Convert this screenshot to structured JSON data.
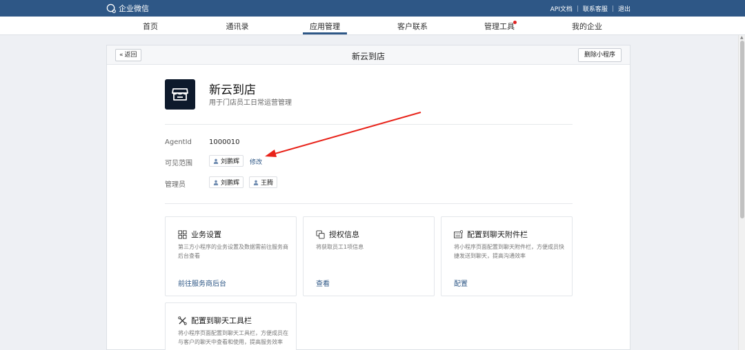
{
  "topbar": {
    "logo_text": "企业微信",
    "links": [
      "API文档",
      "联系客服",
      "退出"
    ]
  },
  "nav": {
    "items": [
      "首页",
      "通讯录",
      "应用管理",
      "客户联系",
      "管理工具",
      "我的企业"
    ],
    "active": "应用管理",
    "notify_color": "#e02020"
  },
  "panel": {
    "back_label": "返回",
    "title": "新云到店",
    "delete_label": "删除小程序"
  },
  "app": {
    "name": "新云到店",
    "description": "用于门店员工日常运营管理",
    "icon": "store-icon"
  },
  "info": {
    "agentid_label": "AgentId",
    "agentid_value": "1000010",
    "visibility_label": "可见范围",
    "visibility_users": [
      "刘鹏辉"
    ],
    "edit_label": "修改",
    "admin_label": "管理员",
    "admins": [
      "刘鹏辉",
      "王腾"
    ]
  },
  "cards": [
    {
      "title": "业务设置",
      "desc": "第三方小程序的业务设置及数据需前往服务商后台查看",
      "link": "前往服务商后台",
      "icon": "grid-icon"
    },
    {
      "title": "授权信息",
      "desc": "将获取员工1项信息",
      "link": "查看",
      "icon": "copy-icon"
    },
    {
      "title": "配置到聊天附件栏",
      "desc": "将小程序页面配置到聊天附件栏，方便成员快捷发送到聊天，提高沟通效率",
      "link": "配置",
      "icon": "keyboard-icon"
    },
    {
      "title": "配置到聊天工具栏",
      "desc": "将小程序页面配置到聊天工具栏，方便成员在与客户的聊天中查看和使用，提高服务效率",
      "link": "",
      "icon": "tools-icon"
    }
  ],
  "colors": {
    "brand": "#2e5786",
    "annotation_arrow": "#e8231a"
  }
}
